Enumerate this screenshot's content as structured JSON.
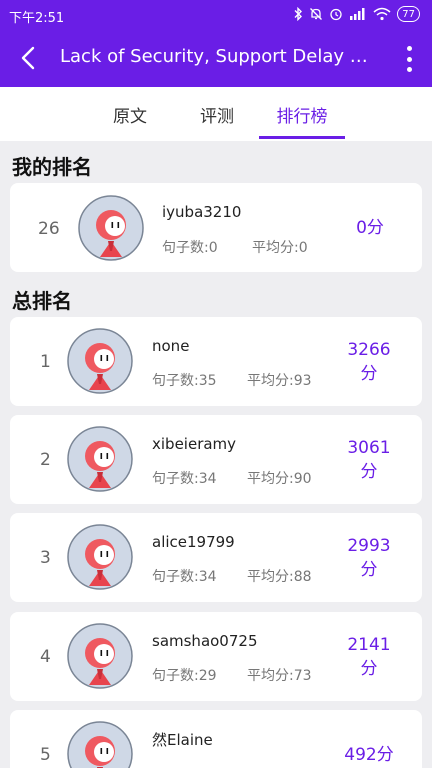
{
  "status_bar": {
    "time": "下午2:51",
    "battery": "77"
  },
  "header": {
    "title": "Lack of Security, Support Delay Afri..."
  },
  "tabs": [
    {
      "label": "原文"
    },
    {
      "label": "评测"
    },
    {
      "label": "排行榜"
    }
  ],
  "my_rank": {
    "section_title": "我的排名",
    "rank": "26",
    "username": "iyuba3210",
    "sentences": "句子数:0",
    "average": "平均分:0",
    "score_line1": "0分",
    "score_line2": ""
  },
  "overall": {
    "section_title": "总排名",
    "rows": [
      {
        "rank": "1",
        "username": "none",
        "sentences": "句子数:35",
        "average": "平均分:93",
        "score_line1": "3266",
        "score_line2": "分"
      },
      {
        "rank": "2",
        "username": "xibeieramy",
        "sentences": "句子数:34",
        "average": "平均分:90",
        "score_line1": "3061",
        "score_line2": "分"
      },
      {
        "rank": "3",
        "username": "alice19799",
        "sentences": "句子数:34",
        "average": "平均分:88",
        "score_line1": "2993",
        "score_line2": "分"
      },
      {
        "rank": "4",
        "username": "samshao0725",
        "sentences": "句子数:29",
        "average": "平均分:73",
        "score_line1": "2141",
        "score_line2": "分"
      },
      {
        "rank": "5",
        "username": "然Elaine",
        "sentences": "",
        "average": "",
        "score_line1": "492分",
        "score_line2": ""
      }
    ]
  },
  "colors": {
    "accent": "#6a1ee6",
    "background": "#eeeef1",
    "card": "#ffffff"
  }
}
